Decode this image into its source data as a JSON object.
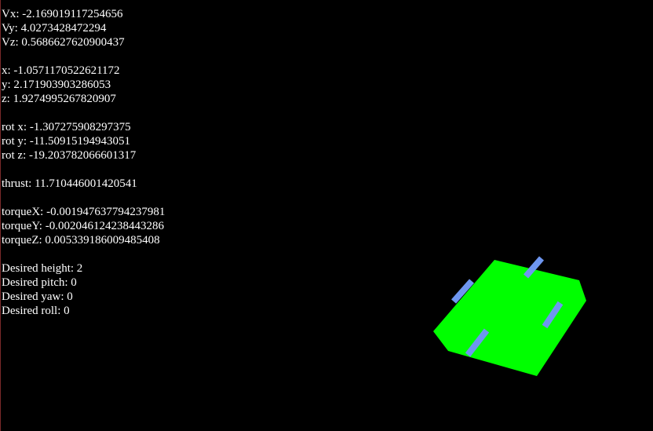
{
  "telemetry": {
    "velocity": {
      "vx": "Vx: -2.169019117254656",
      "vy": "Vy: 4.0273428472294",
      "vz": "Vz: 0.5686627620900437"
    },
    "position": {
      "x": "x: -1.0571170522621172",
      "y": "y: 2.171903903286053",
      "z": "z: 1.9274995267820907"
    },
    "rotation": {
      "x": "rot x: -1.307275908297375",
      "y": "rot y: -11.50915194943051",
      "z": "rot z: -19.203782066601317"
    },
    "thrust": "thrust: 11.710446001420541",
    "torque": {
      "x": "torqueX: -0.001947637794237981",
      "y": "torqueY: -0.002046124238443286",
      "z": "torqueZ: 0.005339186009485408"
    },
    "desired": {
      "height": "Desired height: 2",
      "pitch": "Desired pitch: 0",
      "yaw": "Desired yaw: 0",
      "roll": "Desired roll: 0"
    }
  },
  "scene": {
    "background_color": "#000000",
    "drone_body_color": "#00ff00",
    "rotor_color": "#6e96f0"
  }
}
